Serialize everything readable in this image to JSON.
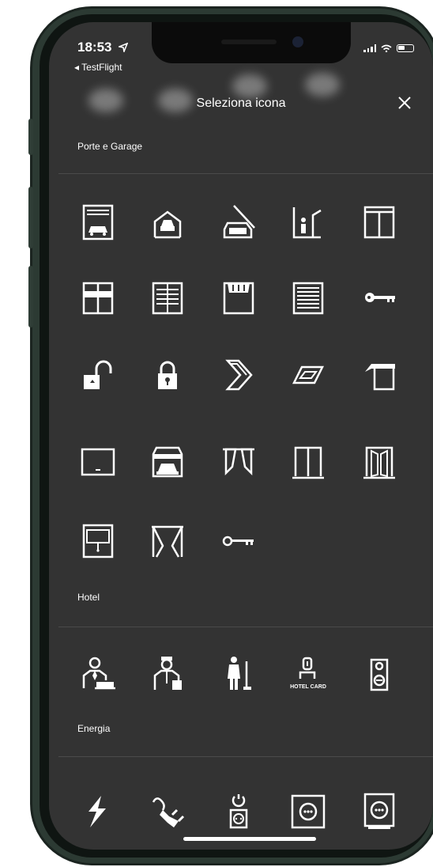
{
  "status": {
    "time": "18:53",
    "back_app": "◂ TestFlight"
  },
  "header": {
    "title": "Seleziona icona"
  },
  "sections": [
    {
      "label": "Porte e Garage"
    },
    {
      "label": "Hotel"
    },
    {
      "label": "Energia"
    }
  ],
  "icons": {
    "porte_garage": [
      "garage-door-icon",
      "car-lift-icon",
      "car-barrier-icon",
      "person-gate-icon",
      "window-top-pane-icon",
      "window-crossbar-icon",
      "shutter-window-icon",
      "awning-window-icon",
      "blinds-window-icon",
      "key-icon",
      "padlock-open-icon",
      "padlock-closed-icon",
      "skylight-open-icon",
      "roof-window-icon",
      "canopy-icon",
      "projector-screen-icon",
      "car-garage-icon",
      "curtains-icon",
      "double-door-icon",
      "door-open-icon",
      "screen-panel-icon",
      "curtain-drawn-icon",
      "key-outline-icon"
    ],
    "hotel": [
      "waiter-icon",
      "bellboy-icon",
      "cleaning-icon",
      "hotel-card-icon",
      "do-not-disturb-icon"
    ],
    "energia": [
      "lightning-icon",
      "plug-icon",
      "power-socket-icon",
      "socket-icon",
      "socket-tall-icon"
    ]
  },
  "hotel_card_text": "HOTEL CARD"
}
